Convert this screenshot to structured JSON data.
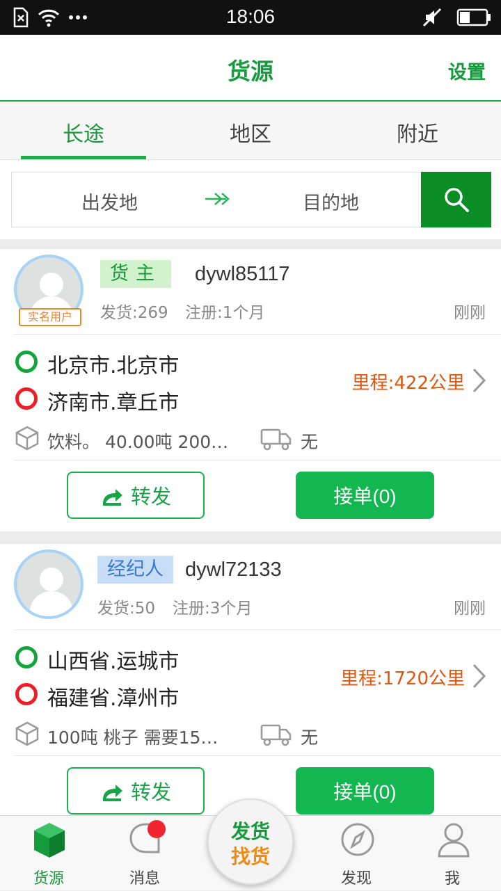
{
  "status_bar": {
    "time": "18:06"
  },
  "header": {
    "title": "货源",
    "settings_label": "设置"
  },
  "tabs": [
    {
      "label": "长途",
      "active": true
    },
    {
      "label": "地区",
      "active": false
    },
    {
      "label": "附近",
      "active": false
    }
  ],
  "search": {
    "from_placeholder": "出发地",
    "to_placeholder": "目的地"
  },
  "listings": [
    {
      "role": "货主",
      "role_color": "#159a3c",
      "username": "dywl85117",
      "verified_label": "实名用户",
      "shipments": "发货:269",
      "registered": "注册:1个月",
      "time_ago": "刚刚",
      "origin": "北京市.北京市",
      "destination": "济南市.章丘市",
      "mileage": "里程:422公里",
      "cargo": "饮料。 40.00吨 200…",
      "truck": "无",
      "forward_label": "转发",
      "accept_label": "接单(0)"
    },
    {
      "role": "经纪人",
      "role_color": "#3979c7",
      "username": "dywl72133",
      "shipments": "发货:50",
      "registered": "注册:3个月",
      "time_ago": "刚刚",
      "origin": "山西省.运城市",
      "destination": "福建省.漳州市",
      "mileage": "里程:1720公里",
      "cargo": "100吨 桃子 需要15…",
      "truck": "无",
      "forward_label": "转发",
      "accept_label": "接单(0)"
    }
  ],
  "bottom_nav": {
    "items": [
      {
        "label": "货源",
        "icon": "cube-icon",
        "active": true
      },
      {
        "label": "消息",
        "icon": "chat-bubble-icon",
        "has_badge": true
      },
      {
        "label": "发现",
        "icon": "compass-icon"
      },
      {
        "label": "我",
        "icon": "person-icon"
      }
    ],
    "center_line1": "发货",
    "center_line2": "找货"
  },
  "colors": {
    "brand_green": "#159a3c",
    "accept_green": "#12b84f",
    "mileage_orange": "#e0560e"
  }
}
